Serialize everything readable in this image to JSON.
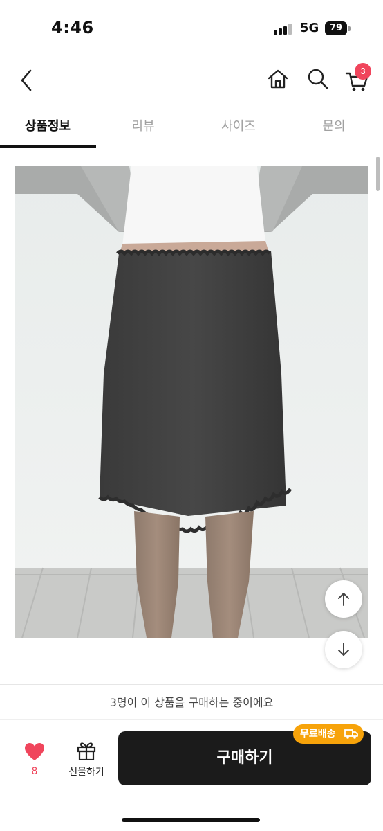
{
  "status_bar": {
    "time": "4:46",
    "network": "5G",
    "battery": "79"
  },
  "header": {
    "back_icon": "chevron-left-icon",
    "home_icon": "home-icon",
    "search_icon": "search-icon",
    "cart_icon": "cart-icon",
    "cart_count": "3"
  },
  "tabs": [
    {
      "label": "상품정보",
      "active": true
    },
    {
      "label": "리뷰",
      "active": false
    },
    {
      "label": "사이즈",
      "active": false
    },
    {
      "label": "문의",
      "active": false
    }
  ],
  "product": {
    "image_subject": "model wearing dark charcoal midi skirt with lettuce-edge trim"
  },
  "floating": {
    "up_icon": "arrow-up-icon",
    "down_icon": "arrow-down-icon"
  },
  "bottom": {
    "buyers_notice": "3명이 이 상품을 구매하는 중이에요",
    "like_count": "8",
    "gift_label": "선물하기",
    "buy_label": "구매하기",
    "free_shipping": "무료배송"
  },
  "colors": {
    "accent_red": "#f0455c",
    "badge_orange": "#f7a30a",
    "button_dark": "#1b1b1b"
  }
}
